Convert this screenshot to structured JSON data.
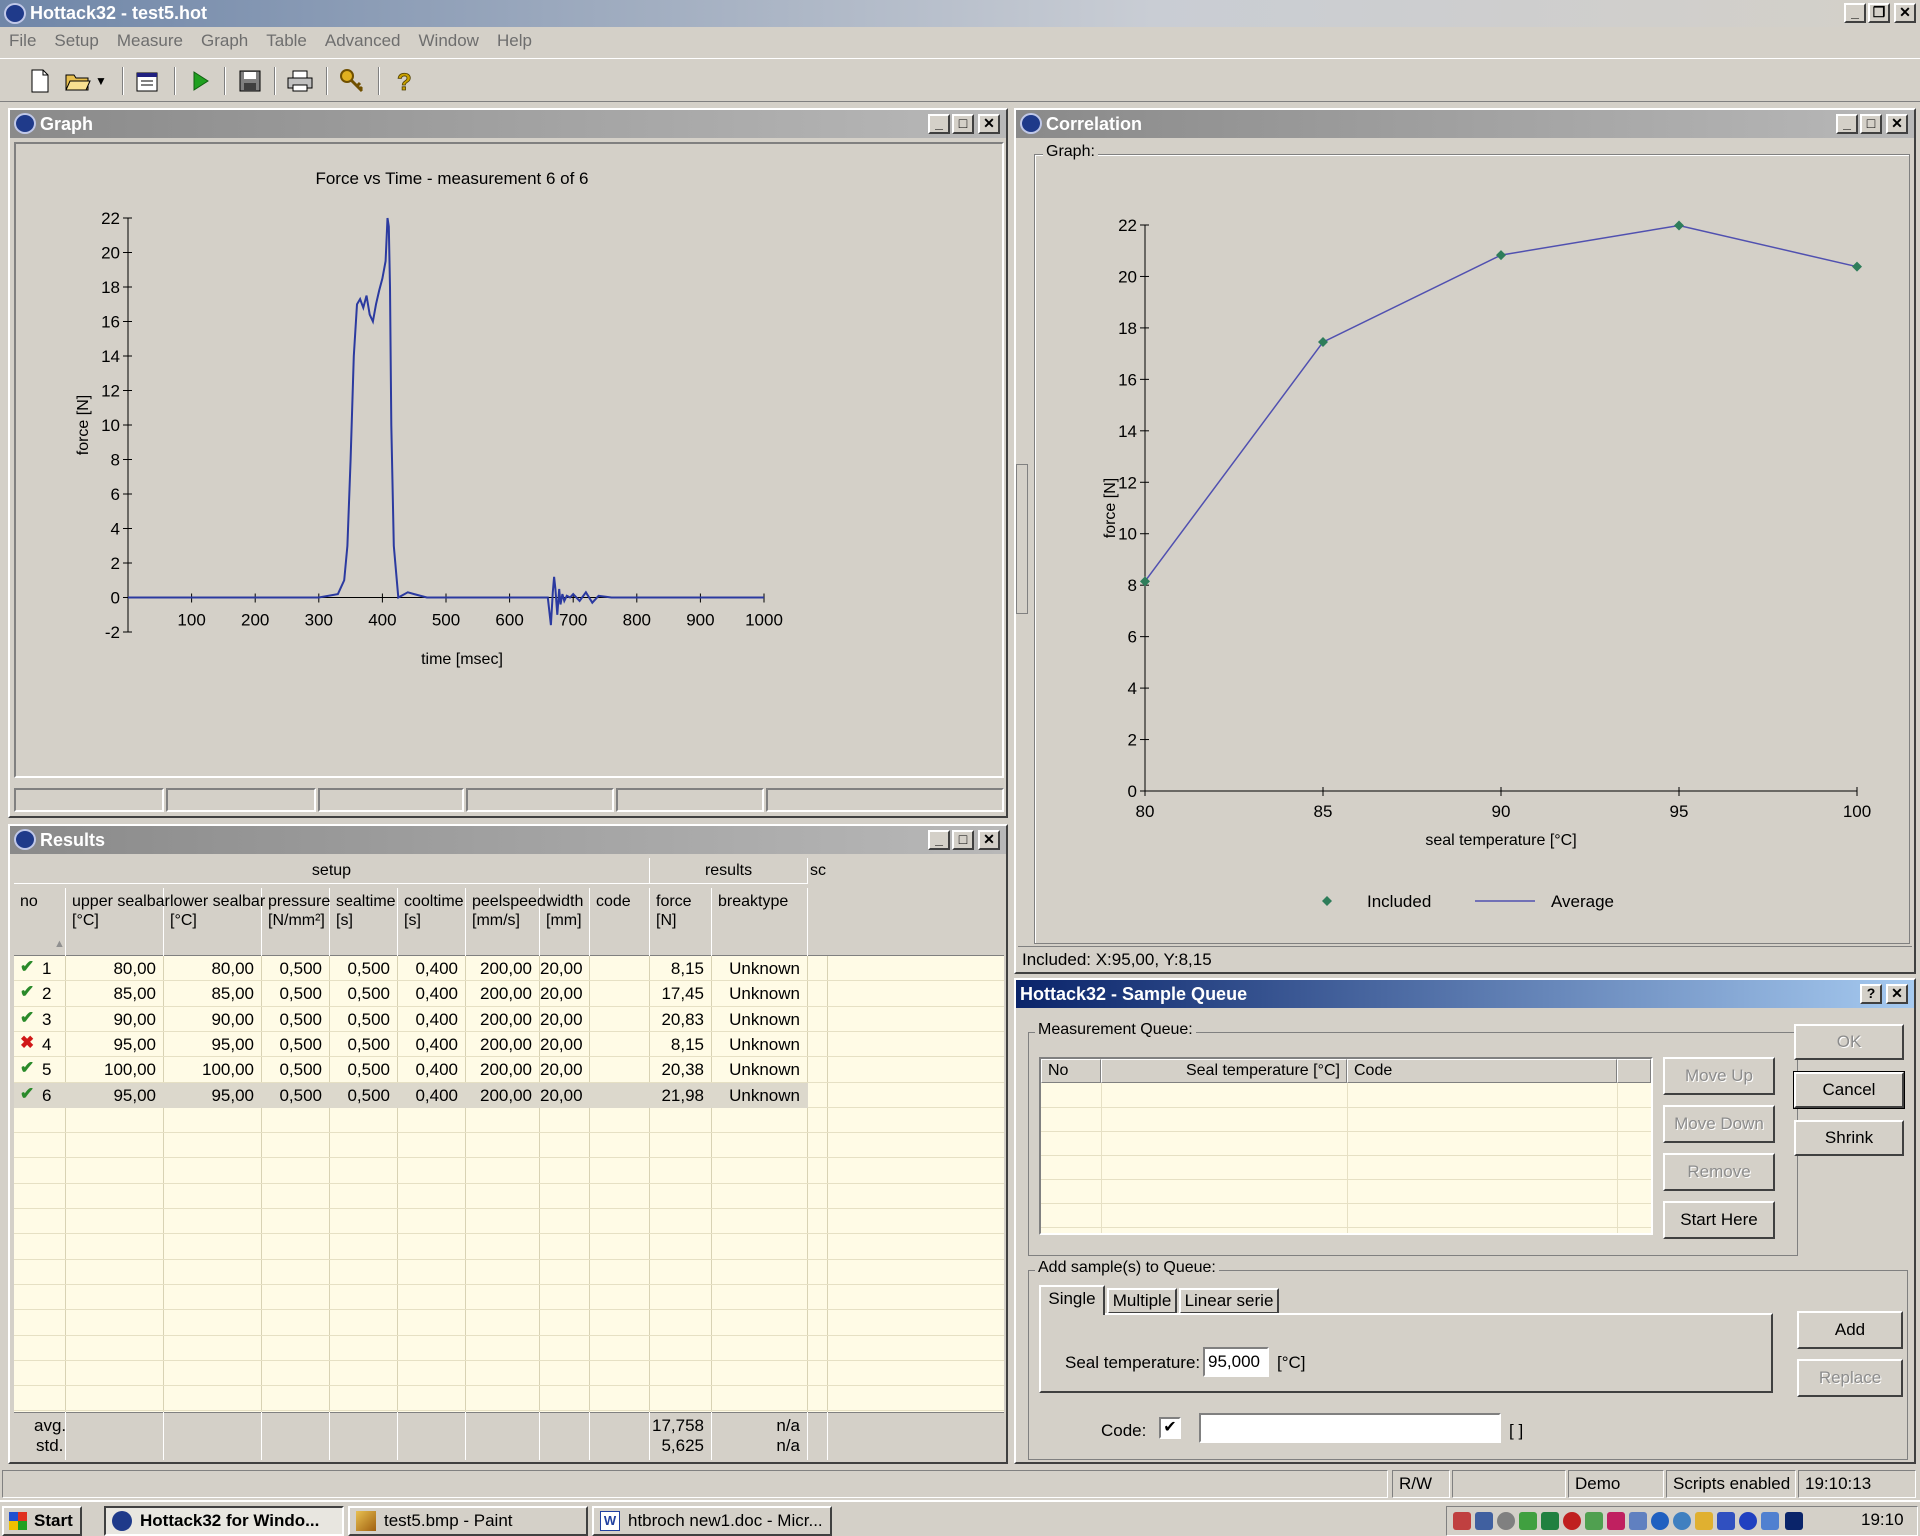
{
  "app": {
    "title": "Hottack32 - test5.hot",
    "menu": [
      "File",
      "Setup",
      "Measure",
      "Graph",
      "Table",
      "Advanced",
      "Window",
      "Help"
    ]
  },
  "graph_window": {
    "title": "Graph"
  },
  "correlation_window": {
    "title": "Correlation",
    "group_label": "Graph:",
    "status": "Included: X:95,00, Y:8,15",
    "legend": {
      "included": "Included",
      "average": "Average"
    }
  },
  "chart_data": [
    {
      "type": "line",
      "title": "Force vs Time - measurement 6 of 6",
      "xlabel": "time [msec]",
      "ylabel": "force [N]",
      "xlim": [
        0,
        1000
      ],
      "ylim": [
        -2,
        22
      ],
      "x_ticks": [
        100,
        200,
        300,
        400,
        500,
        600,
        700,
        800,
        900,
        1000
      ],
      "y_ticks": [
        -2,
        0,
        2,
        4,
        6,
        8,
        10,
        12,
        14,
        16,
        18,
        20,
        22
      ],
      "series": [
        {
          "x": [
            0,
            100,
            200,
            300,
            330,
            340,
            345,
            350,
            355,
            360,
            365,
            370,
            375,
            380,
            385,
            390,
            395,
            400,
            405,
            408,
            410,
            412,
            414,
            418,
            425,
            440,
            450,
            470,
            500,
            600,
            640,
            660,
            665,
            668,
            670,
            672,
            675,
            678,
            680,
            683,
            686,
            690,
            695,
            700,
            710,
            720,
            730,
            740,
            760,
            800,
            860,
            900,
            1000
          ],
          "y": [
            0,
            0,
            0,
            0,
            0.2,
            1,
            3,
            8,
            14,
            17,
            17.3,
            16.8,
            17.5,
            16.4,
            16,
            17,
            17.8,
            18.5,
            19.5,
            22,
            21.5,
            18,
            10,
            3,
            0,
            0.3,
            0.2,
            0,
            0,
            0,
            0,
            0,
            -1.6,
            0.3,
            1.2,
            0.5,
            -1,
            0.5,
            -0.4,
            0.2,
            -0.2,
            0.1,
            0,
            0.2,
            -0.2,
            0.3,
            -0.3,
            0.1,
            0,
            0,
            0,
            0,
            0
          ]
        }
      ]
    },
    {
      "type": "line",
      "title": "",
      "xlabel": "seal temperature [°C]",
      "ylabel": "force [N]",
      "xlim": [
        80,
        100
      ],
      "ylim": [
        0,
        22
      ],
      "x_ticks": [
        80,
        85,
        90,
        95,
        100
      ],
      "y_ticks": [
        0,
        2,
        4,
        6,
        8,
        10,
        12,
        14,
        16,
        18,
        20,
        22
      ],
      "series": [
        {
          "name": "Included",
          "x": [
            80,
            85,
            90,
            95,
            100
          ],
          "y": [
            8.15,
            17.45,
            20.83,
            21.98,
            20.38
          ]
        },
        {
          "name": "Average",
          "x": [
            80,
            85,
            90,
            95,
            100
          ],
          "y": [
            8.15,
            17.45,
            20.83,
            21.98,
            20.38
          ]
        }
      ]
    }
  ],
  "results": {
    "title": "Results",
    "group_setup": "setup",
    "group_results": "results",
    "group_sc": "sc",
    "headers": [
      {
        "l1": "no",
        "l2": ""
      },
      {
        "l1": "upper sealbar",
        "l2": "[°C]"
      },
      {
        "l1": "lower sealbar",
        "l2": "[°C]"
      },
      {
        "l1": "pressure",
        "l2": "[N/mm²]"
      },
      {
        "l1": "sealtime",
        "l2": "[s]"
      },
      {
        "l1": "cooltime",
        "l2": "[s]"
      },
      {
        "l1": "peelspeed",
        "l2": "[mm/s]"
      },
      {
        "l1": "width",
        "l2": "[mm]"
      },
      {
        "l1": "code",
        "l2": ""
      },
      {
        "l1": "force",
        "l2": "[N]"
      },
      {
        "l1": "breaktype",
        "l2": ""
      }
    ],
    "rows": [
      {
        "ok": true,
        "no": "1",
        "upper": "80,00",
        "lower": "80,00",
        "pressure": "0,500",
        "sealtime": "0,500",
        "cooltime": "0,400",
        "peelspeed": "200,00",
        "width": "20,00",
        "code": "",
        "force": "8,15",
        "breaktype": "Unknown"
      },
      {
        "ok": true,
        "no": "2",
        "upper": "85,00",
        "lower": "85,00",
        "pressure": "0,500",
        "sealtime": "0,500",
        "cooltime": "0,400",
        "peelspeed": "200,00",
        "width": "20,00",
        "code": "",
        "force": "17,45",
        "breaktype": "Unknown"
      },
      {
        "ok": true,
        "no": "3",
        "upper": "90,00",
        "lower": "90,00",
        "pressure": "0,500",
        "sealtime": "0,500",
        "cooltime": "0,400",
        "peelspeed": "200,00",
        "width": "20,00",
        "code": "",
        "force": "20,83",
        "breaktype": "Unknown"
      },
      {
        "ok": false,
        "no": "4",
        "upper": "95,00",
        "lower": "95,00",
        "pressure": "0,500",
        "sealtime": "0,500",
        "cooltime": "0,400",
        "peelspeed": "200,00",
        "width": "20,00",
        "code": "",
        "force": "8,15",
        "breaktype": "Unknown"
      },
      {
        "ok": true,
        "no": "5",
        "upper": "100,00",
        "lower": "100,00",
        "pressure": "0,500",
        "sealtime": "0,500",
        "cooltime": "0,400",
        "peelspeed": "200,00",
        "width": "20,00",
        "code": "",
        "force": "20,38",
        "breaktype": "Unknown"
      },
      {
        "ok": true,
        "no": "6",
        "upper": "95,00",
        "lower": "95,00",
        "pressure": "0,500",
        "sealtime": "0,500",
        "cooltime": "0,400",
        "peelspeed": "200,00",
        "width": "20,00",
        "code": "",
        "force": "21,98",
        "breaktype": "Unknown"
      }
    ],
    "footer": {
      "avg_label": "avg.",
      "std_label": "std.",
      "force_avg": "17,758",
      "force_std": "5,625",
      "break_avg": "n/a",
      "break_std": "n/a"
    }
  },
  "queue_dialog": {
    "title": "Hottack32 - Sample Queue",
    "help_btn": "?",
    "measurement_queue_label": "Measurement Queue:",
    "columns": [
      "No",
      "Seal temperature [°C]",
      "Code"
    ],
    "buttons": {
      "move_up": "Move Up",
      "move_down": "Move Down",
      "remove": "Remove",
      "start_here": "Start Here",
      "ok": "OK",
      "cancel": "Cancel",
      "shrink": "Shrink",
      "add": "Add",
      "replace": "Replace"
    },
    "add_label": "Add sample(s) to Queue:",
    "tabs": [
      "Single",
      "Multiple",
      "Linear serie"
    ],
    "seal_temp_label": "Seal temperature:",
    "seal_temp_value": "95,000",
    "seal_temp_unit": "[°C]",
    "code_label": "Code:",
    "code_value": "",
    "code_unit": "[ ]"
  },
  "statusbar": {
    "rw": "R/W",
    "mode": "Demo mode",
    "scripts": "Scripts enabled",
    "time": "19:10:13"
  },
  "taskbar": {
    "start": "Start",
    "tasks": [
      "Hottack32 for Windo...",
      "test5.bmp - Paint",
      "htbroch new1.doc - Micr..."
    ],
    "clock": "19:10"
  },
  "colors": {
    "plot_line": "#2b3aa0",
    "corr_line": "#5050b0",
    "marker": "#2e7d5a",
    "grid_bg": "#fffbe6",
    "ok_check": "#2a8a2a",
    "fail_x": "#d01818"
  },
  "icons": [
    "new-file-icon",
    "open-folder-icon",
    "properties-icon",
    "play-icon",
    "save-disk-icon",
    "printer-icon",
    "key-icon",
    "help-icon"
  ]
}
